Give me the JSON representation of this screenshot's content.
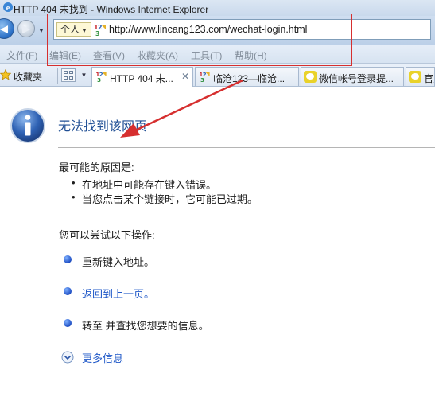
{
  "window": {
    "title": "HTTP 404 未找到 - Windows Internet Explorer"
  },
  "address_bar": {
    "zone_label": "个人",
    "url": "http://www.lincang123.com/wechat-login.html"
  },
  "menu": {
    "items": [
      "文件(F)",
      "编辑(E)",
      "查看(V)",
      "收藏夹(A)",
      "工具(T)",
      "帮助(H)"
    ]
  },
  "favorites_bar": {
    "label": "收藏夹"
  },
  "tabs": [
    {
      "label": "HTTP 404 未...",
      "active": true
    },
    {
      "label": "临沧123—临沧...",
      "active": false
    },
    {
      "label": "微信帐号登录提...",
      "active": false
    },
    {
      "label": "官方",
      "active": false
    }
  ],
  "page": {
    "title": "无法找到该网页",
    "reasons_heading": "最可能的原因是:",
    "reasons": [
      "在地址中可能存在键入错误。",
      "当您点击某个链接时，它可能已过期。"
    ],
    "try_heading": "您可以尝试以下操作:",
    "actions": [
      {
        "text": "重新键入地址。",
        "is_link": false
      },
      {
        "text": "返回到上一页。",
        "is_link": true
      },
      {
        "text": "转至  并查找您想要的信息。",
        "is_link": false
      }
    ],
    "more_info": "更多信息"
  },
  "colors": {
    "annotation_red": "#d62f2f",
    "link_blue": "#1f58c8",
    "title_blue": "#1f4e94"
  }
}
